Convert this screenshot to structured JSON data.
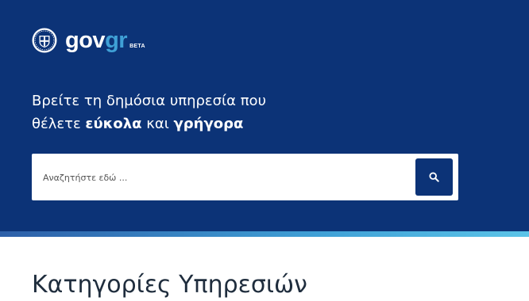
{
  "header": {
    "logo": {
      "text_main": "gov",
      "text_accent": "gr",
      "badge": "BETA",
      "emblem_icon": "greek-coat-of-arms-icon"
    },
    "tagline": {
      "line1": "Βρείτε τη δημόσια υπηρεσία που",
      "line2_prefix": "θέλετε ",
      "line2_bold1": "εύκολα",
      "line2_mid": " και ",
      "line2_bold2": "γρήγορα"
    }
  },
  "search": {
    "placeholder": "Αναζητήστε εδώ ...",
    "value": "",
    "button_icon": "search-icon"
  },
  "main": {
    "section_title": "Κατηγορίες Υπηρεσιών"
  },
  "colors": {
    "hero_background": "#0c3377",
    "accent_blue": "#3fa0d6",
    "button_background": "#0c3377"
  }
}
